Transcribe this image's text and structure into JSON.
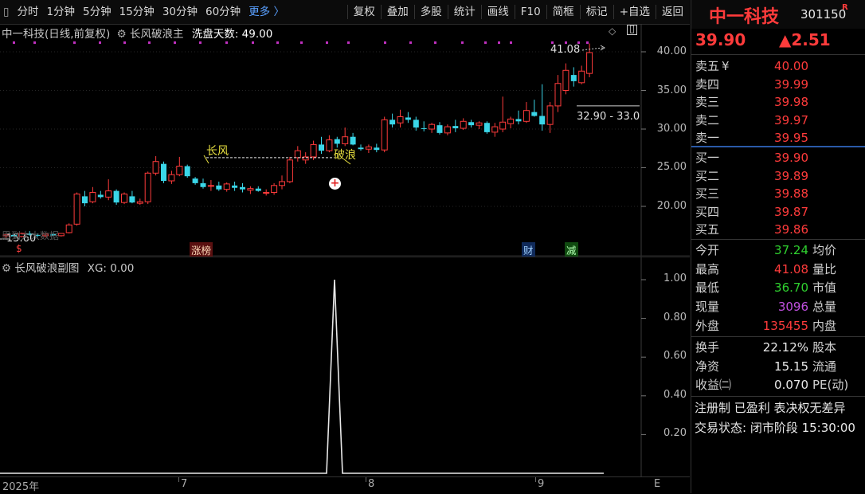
{
  "toolbar": {
    "items": [
      "分时",
      "1分钟",
      "5分钟",
      "15分钟",
      "30分钟",
      "60分钟",
      "更多 〉"
    ],
    "right_items": [
      "复权",
      "叠加",
      "多股",
      "统计",
      "画线",
      "F10",
      "简框",
      "标记",
      "+自选",
      "返回"
    ]
  },
  "main_legend": {
    "stock": "中一科技(日线,前复权)",
    "indicator": "长风破浪主",
    "param": "洗盘天数: 49.00"
  },
  "sub_legend": {
    "indicator": "长风破浪副图",
    "param": "XG: 0.00"
  },
  "main_yaxis": [
    "40.00",
    "35.00",
    "30.00",
    "25.00",
    "20.00"
  ],
  "sub_yaxis": [
    "1.00",
    "0.80",
    "0.60",
    "0.40",
    "0.20"
  ],
  "date_axis": [
    "2025年",
    "7",
    "8",
    "9",
    "E"
  ],
  "annotations": {
    "high_label": "41.08",
    "range_label": "32.90 - 33.0",
    "low_label": "15.60",
    "changfeng": "长风",
    "polang": "破浪",
    "zhangbang": "涨榜",
    "cai": "财",
    "jian": "减",
    "dollar": "$",
    "faded_text": "思到大大数据"
  },
  "quote": {
    "name": "中一科技",
    "code": "301150",
    "badge": "R",
    "price": "39.90",
    "change": "▲2.51",
    "asks": [
      {
        "label": "卖五",
        "sub": "¥",
        "price": "40.00"
      },
      {
        "label": "卖四",
        "sub": "",
        "price": "39.99"
      },
      {
        "label": "卖三",
        "sub": "",
        "price": "39.98"
      },
      {
        "label": "卖二",
        "sub": "",
        "price": "39.97"
      },
      {
        "label": "卖一",
        "sub": "",
        "price": "39.95"
      }
    ],
    "bids": [
      {
        "label": "买一",
        "price": "39.90"
      },
      {
        "label": "买二",
        "price": "39.89"
      },
      {
        "label": "买三",
        "price": "39.88"
      },
      {
        "label": "买四",
        "price": "39.87"
      },
      {
        "label": "买五",
        "price": "39.86"
      }
    ],
    "stats": [
      {
        "label": "今开",
        "value": "37.24",
        "right": "均价",
        "color": "green"
      },
      {
        "label": "最高",
        "value": "41.08",
        "right": "量比",
        "color": "red"
      },
      {
        "label": "最低",
        "value": "36.70",
        "right": "市值",
        "color": "green"
      },
      {
        "label": "现量",
        "value": "3096",
        "right": "总量",
        "color": "purple"
      },
      {
        "label": "外盘",
        "value": "135455",
        "right": "内盘",
        "color": "red"
      }
    ],
    "stats2": [
      {
        "label": "换手",
        "value": "22.12%",
        "right": "股本"
      },
      {
        "label": "净资",
        "value": "15.15",
        "right": "流通"
      },
      {
        "label": "收益㈡",
        "value": "0.070",
        "right": "PE(动)"
      }
    ],
    "tags": "注册制 已盈利 表决权无差异",
    "status": "交易状态: 闭市阶段 15:30:00"
  },
  "candles": [
    [
      16.2,
      16.5,
      15.9,
      16.3
    ],
    [
      16.3,
      16.4,
      16.0,
      16.1
    ],
    [
      16.1,
      16.6,
      16.0,
      16.5
    ],
    [
      16.5,
      16.8,
      16.2,
      16.3
    ],
    [
      16.3,
      16.5,
      16.0,
      16.2
    ],
    [
      16.2,
      16.4,
      16.0,
      16.4
    ],
    [
      16.4,
      16.6,
      16.1,
      16.2
    ],
    [
      16.2,
      16.5,
      16.1,
      16.5
    ],
    [
      16.6,
      17.8,
      16.5,
      17.6
    ],
    [
      17.7,
      21.8,
      17.5,
      21.6
    ],
    [
      21.3,
      22.0,
      20.0,
      20.4
    ],
    [
      20.6,
      22.5,
      20.4,
      21.8
    ],
    [
      21.5,
      22.0,
      21.0,
      21.2
    ],
    [
      21.2,
      23.5,
      20.8,
      22.0
    ],
    [
      22.0,
      22.2,
      20.2,
      20.5
    ],
    [
      20.5,
      21.8,
      20.3,
      21.6
    ],
    [
      21.3,
      22.0,
      20.4,
      20.5
    ],
    [
      20.4,
      21.0,
      20.2,
      20.6
    ],
    [
      20.6,
      24.5,
      20.3,
      24.3
    ],
    [
      24.3,
      26.5,
      24.0,
      25.8
    ],
    [
      25.5,
      25.8,
      23.0,
      23.3
    ],
    [
      23.3,
      24.6,
      22.9,
      24.1
    ],
    [
      24.1,
      26.4,
      23.9,
      25.2
    ],
    [
      25.2,
      25.4,
      23.7,
      23.9
    ],
    [
      23.6,
      23.8,
      22.8,
      23.0
    ],
    [
      23.0,
      23.6,
      22.3,
      22.5
    ],
    [
      22.6,
      23.4,
      22.0,
      22.7
    ],
    [
      22.7,
      23.2,
      22.0,
      22.2
    ],
    [
      22.2,
      23.1,
      21.9,
      22.9
    ],
    [
      22.7,
      23.2,
      22.0,
      22.4
    ],
    [
      22.5,
      23.0,
      21.8,
      22.2
    ],
    [
      22.1,
      22.6,
      21.6,
      22.3
    ],
    [
      22.3,
      22.6,
      21.9,
      22.0
    ],
    [
      21.7,
      22.2,
      21.4,
      21.8
    ],
    [
      21.8,
      23.0,
      21.5,
      22.7
    ],
    [
      22.7,
      24.0,
      22.2,
      23.2
    ],
    [
      23.2,
      26.4,
      23.0,
      26.0
    ],
    [
      26.3,
      27.8,
      25.8,
      27.2
    ],
    [
      26.0,
      27.0,
      25.5,
      26.4
    ],
    [
      26.4,
      28.5,
      26.0,
      28.0
    ],
    [
      28.0,
      29.0,
      26.8,
      27.2
    ],
    [
      27.2,
      29.2,
      27.0,
      28.6
    ],
    [
      28.7,
      29.0,
      27.6,
      28.1
    ],
    [
      28.1,
      30.2,
      27.8,
      29.0
    ],
    [
      29.0,
      29.5,
      27.9,
      28.0
    ],
    [
      27.6,
      28.0,
      27.2,
      27.4
    ],
    [
      27.4,
      28.0,
      26.9,
      27.7
    ],
    [
      27.6,
      28.1,
      27.0,
      27.3
    ],
    [
      27.3,
      31.6,
      27.0,
      31.2
    ],
    [
      31.2,
      32.0,
      30.2,
      30.6
    ],
    [
      30.8,
      32.5,
      30.2,
      31.6
    ],
    [
      31.5,
      32.2,
      30.8,
      31.2
    ],
    [
      31.2,
      31.6,
      29.8,
      30.2
    ],
    [
      30.1,
      31.0,
      29.7,
      30.0
    ],
    [
      30.0,
      30.8,
      29.5,
      30.6
    ],
    [
      30.5,
      30.9,
      29.3,
      29.5
    ],
    [
      29.5,
      30.6,
      29.2,
      30.3
    ],
    [
      30.4,
      31.2,
      29.6,
      30.1
    ],
    [
      30.1,
      31.4,
      29.9,
      31.0
    ],
    [
      30.9,
      31.2,
      30.2,
      30.5
    ],
    [
      30.5,
      31.0,
      30.0,
      30.8
    ],
    [
      30.8,
      31.0,
      29.4,
      29.6
    ],
    [
      29.6,
      30.8,
      29.0,
      30.3
    ],
    [
      30.0,
      34.2,
      29.6,
      30.9
    ],
    [
      30.7,
      31.6,
      30.1,
      31.3
    ],
    [
      31.3,
      32.4,
      30.6,
      31.0
    ],
    [
      31.0,
      33.5,
      30.8,
      32.4
    ],
    [
      32.2,
      33.8,
      31.6,
      31.7
    ],
    [
      31.7,
      35.8,
      29.8,
      30.6
    ],
    [
      30.6,
      33.5,
      29.5,
      33.0
    ],
    [
      33.0,
      37.0,
      32.2,
      35.9
    ],
    [
      35.0,
      38.5,
      34.5,
      37.6
    ],
    [
      37.0,
      38.0,
      35.5,
      36.2
    ],
    [
      36.0,
      38.2,
      35.8,
      37.5
    ],
    [
      37.2,
      41.08,
      36.7,
      39.9
    ]
  ]
}
